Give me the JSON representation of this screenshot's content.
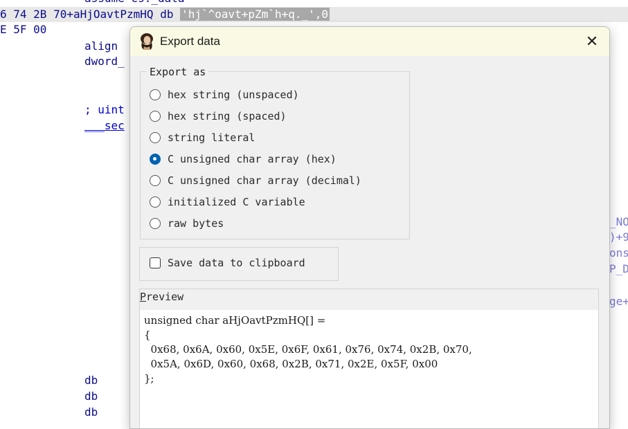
{
  "background": {
    "top_partial": "assume cs:_data",
    "line1_prefix": "6 74 2B 70+aHjOavtPzmHQ db ",
    "line1_string": "'hj`^oavt+pZm`h+q._',0",
    "line2": "E 5F 00",
    "align": "align",
    "dword": "dword_",
    "comment": "; uint",
    "sec": "___sec",
    "db1": "db",
    "db2": "db",
    "db3": "db",
    "right1": "_NO",
    "right2": ")+9",
    "right3": "ons",
    "right4": "P_D",
    "right5": "ge+"
  },
  "dialog": {
    "title": "Export data",
    "close_glyph": "✕",
    "export_as": {
      "label": "Export as",
      "options": [
        {
          "label": "hex string (unspaced)",
          "checked": false
        },
        {
          "label": "hex string (spaced)",
          "checked": false
        },
        {
          "label": "string literal",
          "checked": false
        },
        {
          "label": "C unsigned char array (hex)",
          "checked": true
        },
        {
          "label": "C unsigned char array (decimal)",
          "checked": false
        },
        {
          "label": "initialized C variable",
          "checked": false
        },
        {
          "label": "raw bytes",
          "checked": false
        }
      ]
    },
    "clipboard": {
      "label": "Save data to clipboard",
      "checked": false
    },
    "preview": {
      "label_accel": "P",
      "label_rest": "review",
      "line1": "unsigned char aHjOavtPzmHQ[] =",
      "line2": "{",
      "line3": "  0x68, 0x6A, 0x60, 0x5E, 0x6F, 0x61, 0x76, 0x74, 0x2B, 0x70,",
      "line4": "  0x5A, 0x6D, 0x60, 0x68, 0x2B, 0x71, 0x2E, 0x5F, 0x00",
      "line5": "};"
    }
  }
}
